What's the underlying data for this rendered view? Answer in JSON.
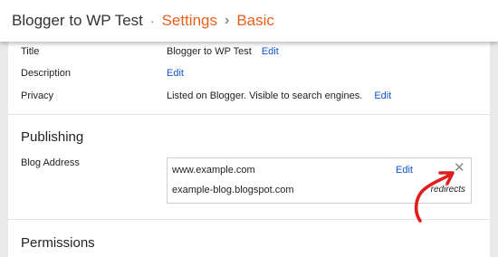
{
  "header": {
    "blog_name": "Blogger to WP Test",
    "separator": "·",
    "settings_crumb": "Settings",
    "arrow": "›",
    "page_crumb": "Basic"
  },
  "basic": {
    "title_label": "Title",
    "title_value": "Blogger to WP Test",
    "description_label": "Description",
    "privacy_label": "Privacy",
    "privacy_value": "Listed on Blogger. Visible to search engines.",
    "edit_label": "Edit"
  },
  "publishing": {
    "heading": "Publishing",
    "blog_address_label": "Blog Address",
    "custom_domain": "www.example.com",
    "blogspot_address": "example-blog.blogspot.com",
    "redirects_label": "redirects",
    "edit_label": "Edit",
    "remove_glyph": "✕"
  },
  "permissions": {
    "heading": "Permissions"
  },
  "colors": {
    "accent_orange": "#e8601c",
    "link_blue": "#1155cc",
    "annotation_red": "#e01e1e"
  },
  "icons": {
    "remove_icon": "close-icon",
    "annotation": "hand-drawn-arrow-icon"
  }
}
